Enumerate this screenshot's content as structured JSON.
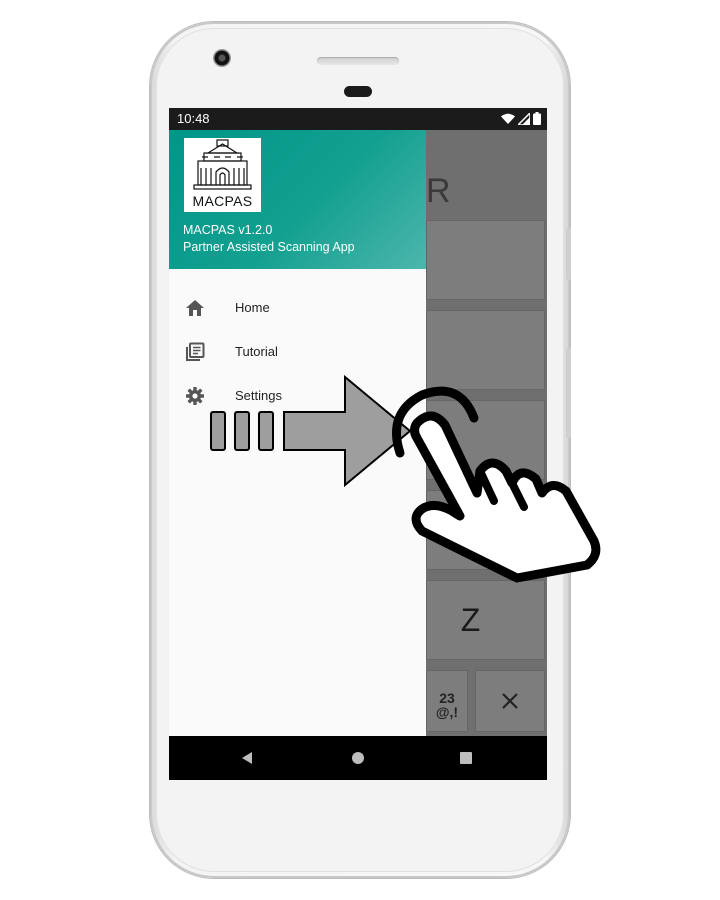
{
  "status_bar": {
    "time": "10:48"
  },
  "drawer": {
    "logo_text": "MACPAS",
    "app_version": "MACPAS v1.2.0",
    "app_subtitle": "Partner Assisted Scanning App",
    "items": [
      {
        "label": "Home",
        "icon": "home-icon"
      },
      {
        "label": "Tutorial",
        "icon": "library-books-icon"
      },
      {
        "label": "Settings",
        "icon": "gear-icon"
      }
    ]
  },
  "background_keyboard": {
    "title_fragment": "R",
    "key_z": "Z",
    "key_symbols_line1": "23",
    "key_symbols_line2": "@,!",
    "key_delete_icon": "close-icon"
  },
  "overlay": {
    "swipe_arrow_icon": "swipe-right-arrow-icon",
    "hand_icon": "tap-hand-icon"
  },
  "colors": {
    "drawer_header": "#009688",
    "drawer_background": "#fafafa",
    "scrim": "#6e6e6e",
    "navbar": "#000000"
  }
}
